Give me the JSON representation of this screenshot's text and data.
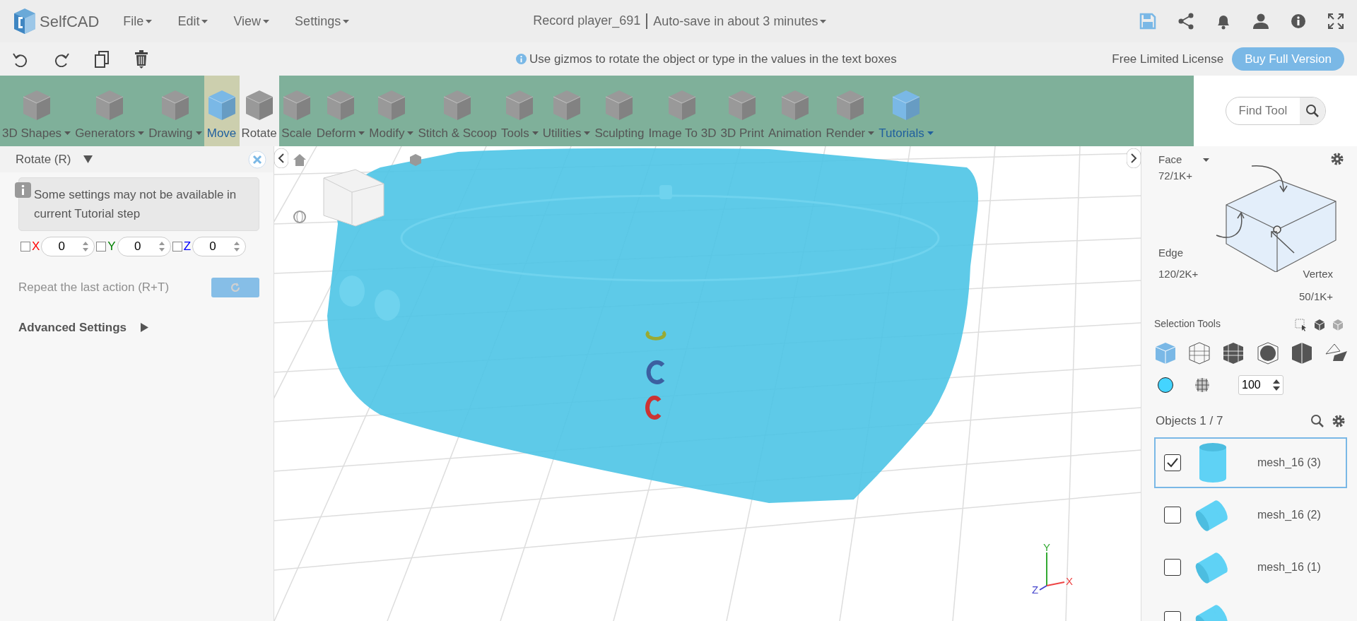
{
  "app": {
    "logo": "SelfCAD",
    "menus": [
      {
        "label": "File"
      },
      {
        "label": "Edit"
      },
      {
        "label": "View"
      },
      {
        "label": "Settings"
      }
    ],
    "document_title": "Record player_691",
    "autosave": "Auto-save in about 3 minutes"
  },
  "action_bar": {
    "hint": "Use gizmos to rotate the object or type in the values in the text boxes",
    "license": "Free Limited License",
    "buy_button": "Buy Full Version"
  },
  "toolbar": {
    "tools": [
      {
        "label": "3D Shapes",
        "dropdown": true,
        "selected": false,
        "hovered": false,
        "highlighted": false
      },
      {
        "label": "Generators",
        "dropdown": true,
        "selected": false,
        "hovered": false,
        "highlighted": false
      },
      {
        "label": "Drawing",
        "dropdown": true,
        "selected": false,
        "hovered": false,
        "highlighted": false
      },
      {
        "label": "Move",
        "dropdown": false,
        "selected": false,
        "hovered": true,
        "highlighted": true
      },
      {
        "label": "Rotate",
        "dropdown": false,
        "selected": true,
        "hovered": false,
        "highlighted": false
      },
      {
        "label": "Scale",
        "dropdown": false,
        "selected": false,
        "hovered": false,
        "highlighted": false
      },
      {
        "label": "Deform",
        "dropdown": true,
        "selected": false,
        "hovered": false,
        "highlighted": false
      },
      {
        "label": "Modify",
        "dropdown": true,
        "selected": false,
        "hovered": false,
        "highlighted": false
      },
      {
        "label": "Stitch & Scoop",
        "dropdown": false,
        "selected": false,
        "hovered": false,
        "highlighted": false
      },
      {
        "label": "Tools",
        "dropdown": true,
        "selected": false,
        "hovered": false,
        "highlighted": false
      },
      {
        "label": "Utilities",
        "dropdown": true,
        "selected": false,
        "hovered": false,
        "highlighted": false
      },
      {
        "label": "Sculpting",
        "dropdown": false,
        "selected": false,
        "hovered": false,
        "highlighted": false
      },
      {
        "label": "Image To 3D",
        "dropdown": false,
        "selected": false,
        "hovered": false,
        "highlighted": false
      },
      {
        "label": "3D Print",
        "dropdown": false,
        "selected": false,
        "hovered": false,
        "highlighted": false
      },
      {
        "label": "Animation",
        "dropdown": false,
        "selected": false,
        "hovered": false,
        "highlighted": false
      },
      {
        "label": "Render",
        "dropdown": true,
        "selected": false,
        "hovered": false,
        "highlighted": false
      },
      {
        "label": "Tutorials",
        "dropdown": true,
        "selected": false,
        "hovered": false,
        "highlighted": true
      }
    ],
    "find_tool": {
      "placeholder": "Find Tool"
    }
  },
  "tool_panel": {
    "title": "Rotate (R)",
    "notice": "Some settings may not be available in current Tutorial step",
    "axes": [
      {
        "label": "X",
        "checked": false,
        "value": "0",
        "color": "#ff0000"
      },
      {
        "label": "Y",
        "checked": false,
        "value": "0",
        "color": "#008000"
      },
      {
        "label": "Z",
        "checked": false,
        "value": "0",
        "color": "#0000ff"
      }
    ],
    "repeat": {
      "label": "Repeat the last action (R+T)",
      "disabled": true
    },
    "advanced": "Advanced Settings"
  },
  "viewport": {
    "axis_labels": [
      "Y",
      "Z",
      "X"
    ]
  },
  "selection_panel": {
    "face": {
      "label": "Face",
      "count": "72/1K+"
    },
    "edge": {
      "label": "Edge",
      "count": "120/2K+"
    },
    "vertex": {
      "label": "Vertex",
      "count": "50/1K+"
    },
    "selection_tools_label": "Selection Tools",
    "modes": [
      {
        "selected": true
      },
      {
        "selected": false
      },
      {
        "selected": false
      },
      {
        "selected": false
      },
      {
        "selected": false
      },
      {
        "selected": false
      }
    ],
    "color": "#44d4ff",
    "opacity": "100",
    "objects_title": "Objects 1 / 7",
    "objects": [
      {
        "label": "mesh_16 (3)",
        "checked": true,
        "selected": true
      },
      {
        "label": "mesh_16 (2)",
        "checked": false,
        "selected": false
      },
      {
        "label": "mesh_16 (1)",
        "checked": false,
        "selected": false
      },
      {
        "checked": false,
        "selected": false
      }
    ]
  }
}
